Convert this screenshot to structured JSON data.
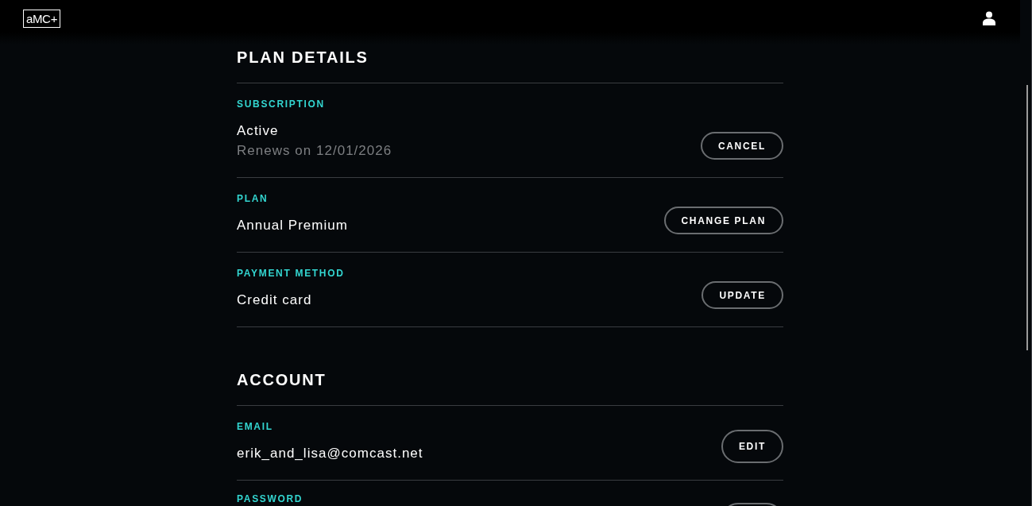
{
  "header": {
    "logo": "aMC+"
  },
  "sections": [
    {
      "kind": "plan",
      "title": "PLAN DETAILS",
      "rows": [
        {
          "label": "SUBSCRIPTION",
          "value": "Active",
          "note": "Renews on 12/01/2026",
          "button": "CANCEL"
        },
        {
          "label": "PLAN",
          "value": "Annual Premium",
          "button": "CHANGE PLAN"
        },
        {
          "label": "PAYMENT METHOD",
          "value": "Credit card",
          "button": "UPDATE"
        }
      ]
    },
    {
      "kind": "account",
      "title": "ACCOUNT",
      "rows": [
        {
          "label": "EMAIL",
          "value": "erik_and_lisa@comcast.net",
          "button": "EDIT"
        },
        {
          "label": "PASSWORD",
          "button_cut": true
        }
      ]
    }
  ]
}
